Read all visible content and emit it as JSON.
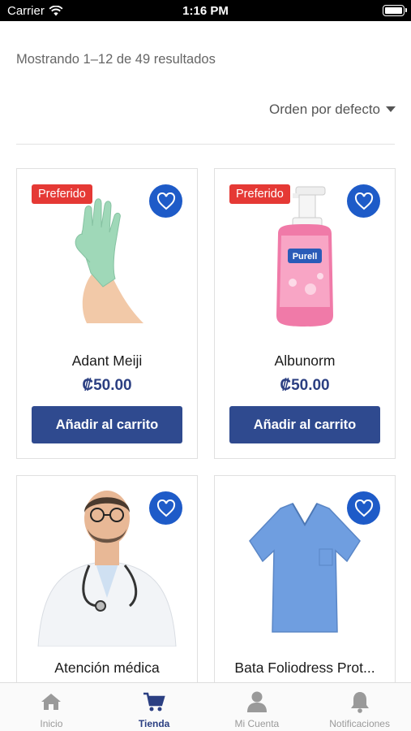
{
  "status_bar": {
    "carrier": "Carrier",
    "time": "1:16 PM"
  },
  "results_text": "Mostrando 1–12 de 49 resultados",
  "sort": {
    "selected": "Orden por defecto"
  },
  "products": [
    {
      "name": "Adant Meiji",
      "price": "₡50.00",
      "badge": "Preferido",
      "button": "Añadir al carrito",
      "image": "glove-image"
    },
    {
      "name": "Albunorm",
      "price": "₡50.00",
      "badge": "Preferido",
      "button": "Añadir al carrito",
      "image": "sanitizer-bottle-image"
    },
    {
      "name": "Atención médica",
      "image": "doctor-image"
    },
    {
      "name": "Bata Foliodress Prot...",
      "image": "scrubs-image"
    }
  ],
  "tabbar": {
    "items": [
      {
        "label": "Inicio",
        "icon": "home-icon"
      },
      {
        "label": "Tienda",
        "icon": "cart-icon",
        "active": true
      },
      {
        "label": "Mi Cuenta",
        "icon": "user-icon"
      },
      {
        "label": "Notificaciones",
        "icon": "bell-icon"
      }
    ]
  },
  "colors": {
    "accent": "#2f4a8f",
    "price": "#2b3f82",
    "badge": "#e53935",
    "fav": "#1e5bc8"
  }
}
